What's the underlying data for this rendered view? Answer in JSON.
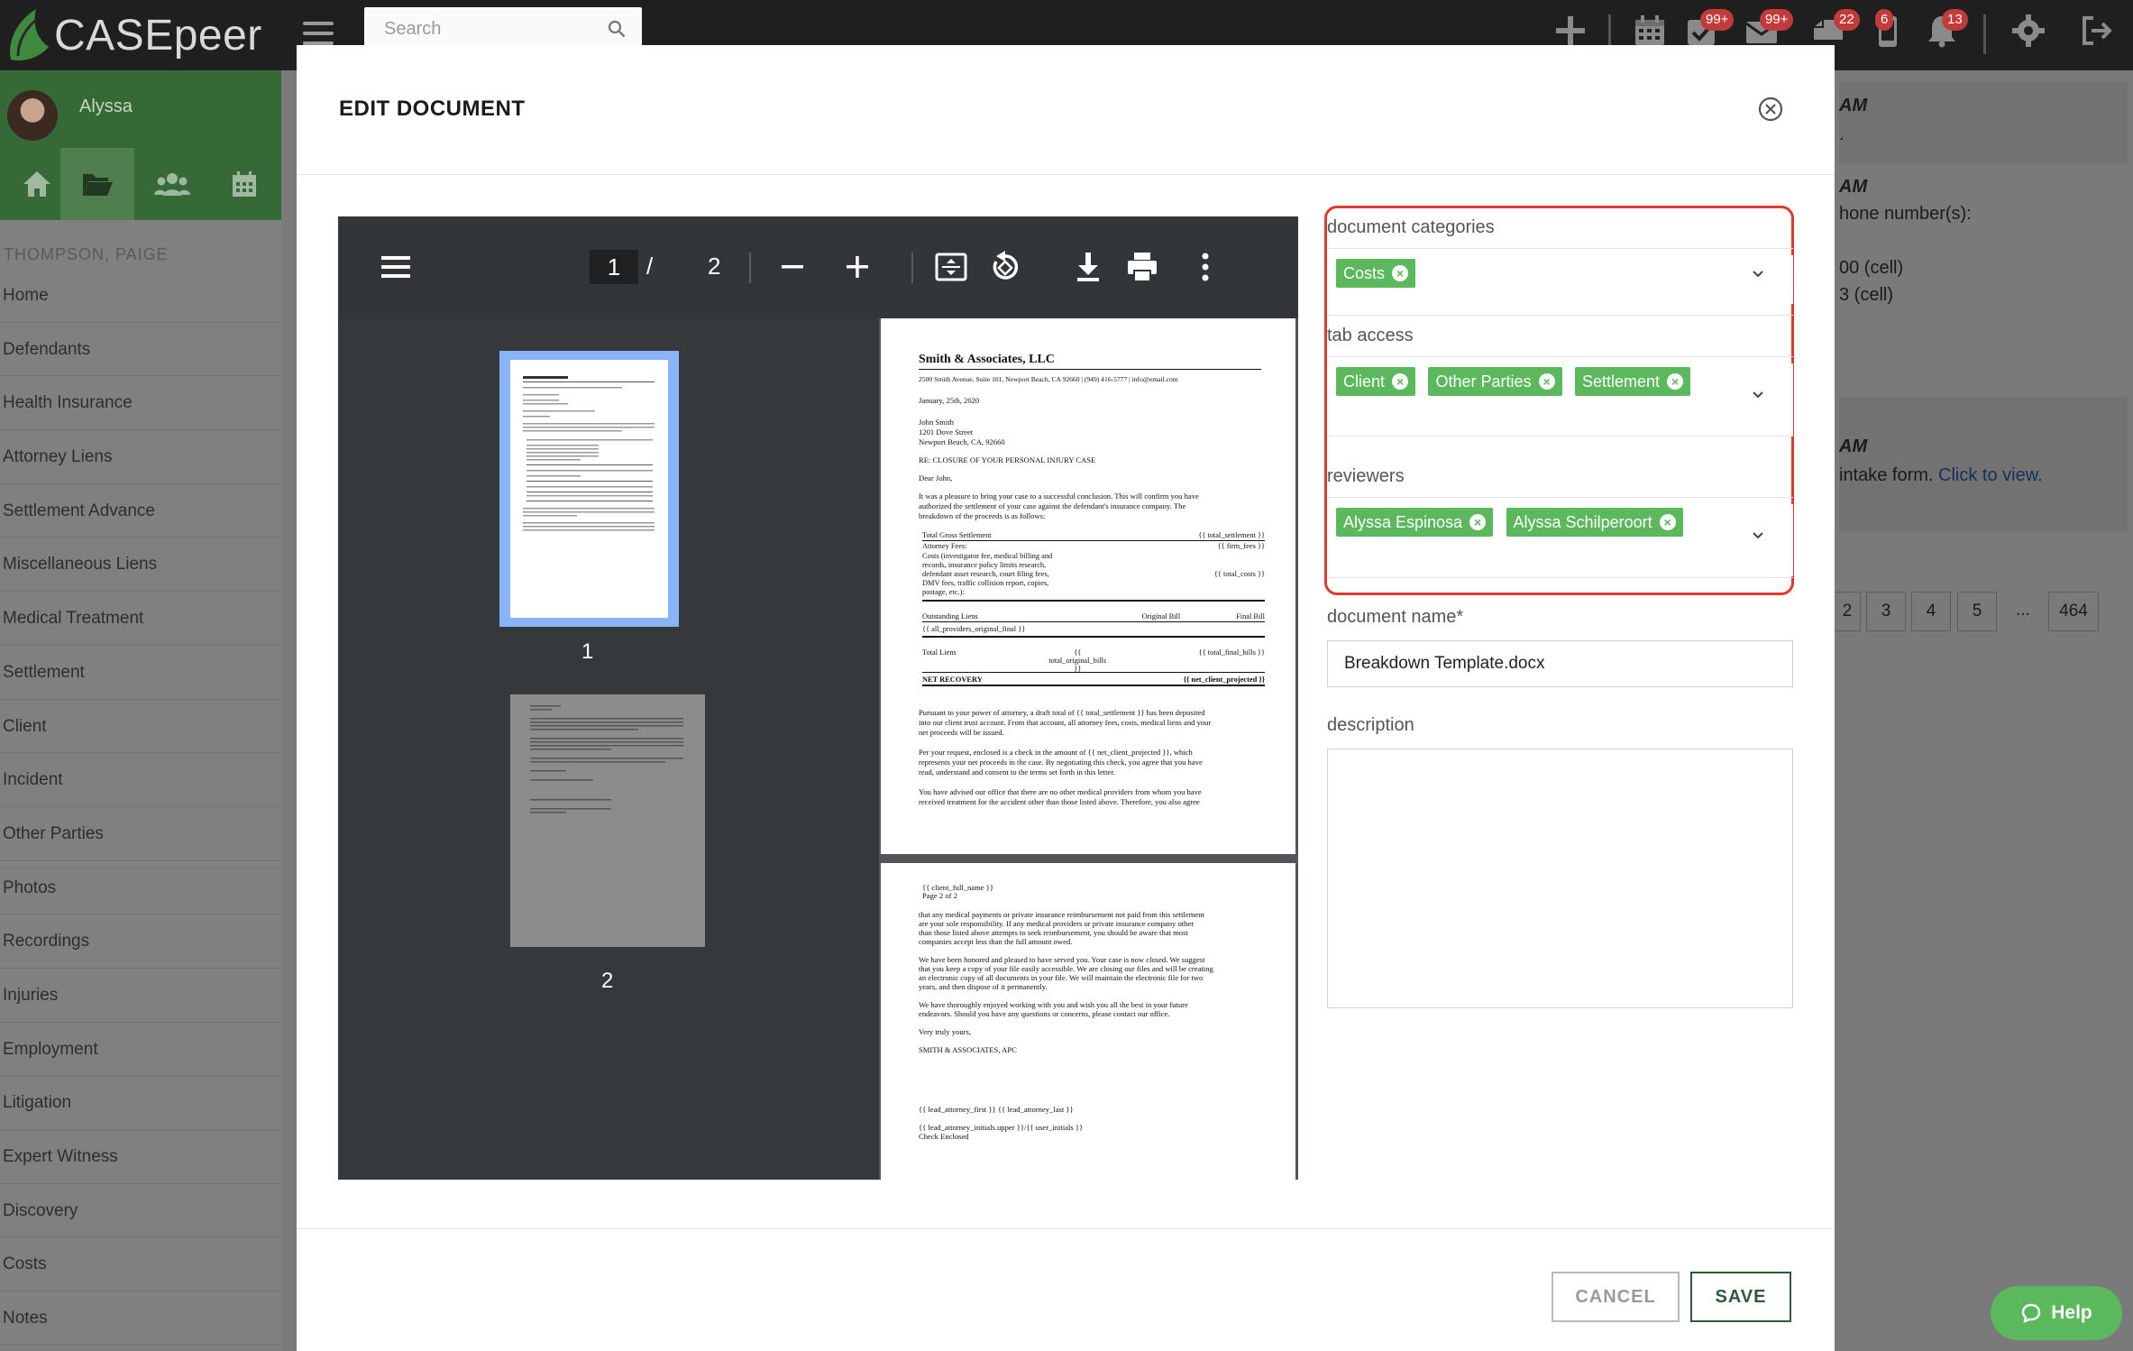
{
  "app": {
    "logo_text": "CASEpeer"
  },
  "topbar": {
    "search_placeholder": "Search",
    "badges": {
      "tasks": "99+",
      "mail": "99+",
      "messages": "22",
      "phone": "6",
      "notifications": "13"
    }
  },
  "sidebar": {
    "user_name": "Alyssa",
    "case_name": "THOMPSON, PAIGE",
    "items": [
      "Home",
      "Defendants",
      "Health Insurance",
      "Attorney Liens",
      "Settlement Advance",
      "Miscellaneous Liens",
      "Medical Treatment",
      "Settlement",
      "Client",
      "Incident",
      "Other Parties",
      "Photos",
      "Recordings",
      "Injuries",
      "Employment",
      "Litigation",
      "Expert Witness",
      "Discovery",
      "Costs",
      "Notes"
    ]
  },
  "background": {
    "line1": "AM",
    "line2": ".",
    "line3": "AM",
    "line4": "hone number(s):",
    "line5": "00 (cell)",
    "line6": "3 (cell)",
    "line7": "AM",
    "line8_text": "intake form.",
    "line8_link": "Click to view.",
    "pages": [
      "2",
      "3",
      "4",
      "5",
      "...",
      "464"
    ]
  },
  "modal": {
    "title": "EDIT DOCUMENT",
    "viewer": {
      "current_page": "1",
      "separator": "/",
      "total_pages": "2",
      "thumb1_label": "1",
      "thumb2_label": "2"
    },
    "document": {
      "firm": "Smith & Associates, LLC",
      "address": "2500 Smith Avenue, Suite 101, Newport Beach, CA 92660  |  (949) 416-5777  |  info@email.com",
      "date": "January, 25th, 2020",
      "recipient": [
        "John Smith",
        "1201 Dove Street",
        "Newport Beach, CA, 92660"
      ],
      "re": "RE:  CLOSURE OF YOUR PERSONAL INJURY CASE",
      "salutation": "Dear John,",
      "intro": [
        "It was a pleasure to bring your case to a successful conclusion. This will confirm you have",
        "authorized the settlement of your case against the defendant's insurance company. The",
        "breakdown of the proceeds is as follows:"
      ],
      "rows": [
        [
          "Total Gross Settlement",
          "{{ total_settlement }}"
        ],
        [
          "Attorney Fees:",
          "{{ firm_fees }}"
        ],
        [
          "Costs (investigator fee, medical billing and",
          ""
        ],
        [
          "records, insurance policy limits research,",
          ""
        ],
        [
          "defendant asset research, court filing fees,",
          "{{ total_costs }}"
        ],
        [
          "DMV fees, traffic collision report, copies,",
          ""
        ],
        [
          "postage, etc.):",
          ""
        ]
      ],
      "liens_header": [
        "Outstanding Liens",
        "Original Bill",
        "Final Bill"
      ],
      "liens_row": "{{ all_providers_original_final }}",
      "total_liens": [
        "Total Liens",
        "{{ total_original_bills }}",
        "{{ total_final_bills }}"
      ],
      "net_recovery": [
        "NET RECOVERY",
        "{{ net_client_projected }}"
      ],
      "p1_tail": [
        "Pursuant to your power of attorney, a draft total of {{ total_settlement }} has been deposited",
        "into our client trust account. From that account, all attorney fees, costs, medical liens and your",
        "net proceeds will be issued.",
        "",
        "Per your request, enclosed is a check in the amount of {{ net_client_projected }}, which",
        "represents your net proceeds in the case. By negotiating this check, you agree that you have",
        "read, understand and consent to the terms set forth in this letter.",
        "",
        "You have advised our office that there are no other medical providers from whom you have",
        "received treatment for the accident other than those listed above. Therefore, you also agree"
      ],
      "p2_header": [
        "{{ client_full_name }}",
        "Page 2 of 2"
      ],
      "p2_body": [
        "that any medical payments or private insurance reimbursement not paid from this settlement",
        "are your sole responsibility. If any medical providers or private insurance company other",
        "than those listed above attempts to seek reimbursement, you should be aware that most",
        "companies accept less than the full amount owed.",
        "",
        "We have been honored and pleased to have served you. Your case is now closed. We suggest",
        "that you keep a copy of your file easily accessible. We are closing our files and will be creating",
        "an electronic copy of all documents in your file. We will maintain the electronic file for two",
        "years, and then dispose of it permanently.",
        "",
        "We have thoroughly enjoyed working with you and wish you all the best in your future",
        "endeavors. Should you have any questions or concerns, please contact our office.",
        "",
        "Very truly yours,",
        "",
        "SMITH & ASSOCIATES, APC",
        "",
        "",
        "",
        "",
        "{{ lead_attorney_first }} {{ lead_attorney_last }}",
        "",
        "{{ lead_attorney_initials.upper }}/{{ user_initials }}",
        "Check Enclosed"
      ]
    },
    "form": {
      "categories_label": "document categories",
      "categories": [
        "Costs"
      ],
      "tab_access_label": "tab access",
      "tab_access": [
        "Client",
        "Other Parties",
        "Settlement"
      ],
      "reviewers_label": "reviewers",
      "reviewers": [
        "Alyssa Espinosa",
        "Alyssa Schilperoort"
      ],
      "doc_name_label": "document name",
      "doc_name_required": "*",
      "doc_name_value": "Breakdown Template.docx",
      "description_label": "description",
      "description_value": ""
    },
    "buttons": {
      "cancel": "CANCEL",
      "save": "SAVE"
    }
  },
  "help": {
    "label": "Help"
  },
  "colors": {
    "brand_green": "#356a37",
    "tag_green": "#5cb85c",
    "highlight_red": "#e03a2f",
    "save_green": "#2c5b3a"
  }
}
